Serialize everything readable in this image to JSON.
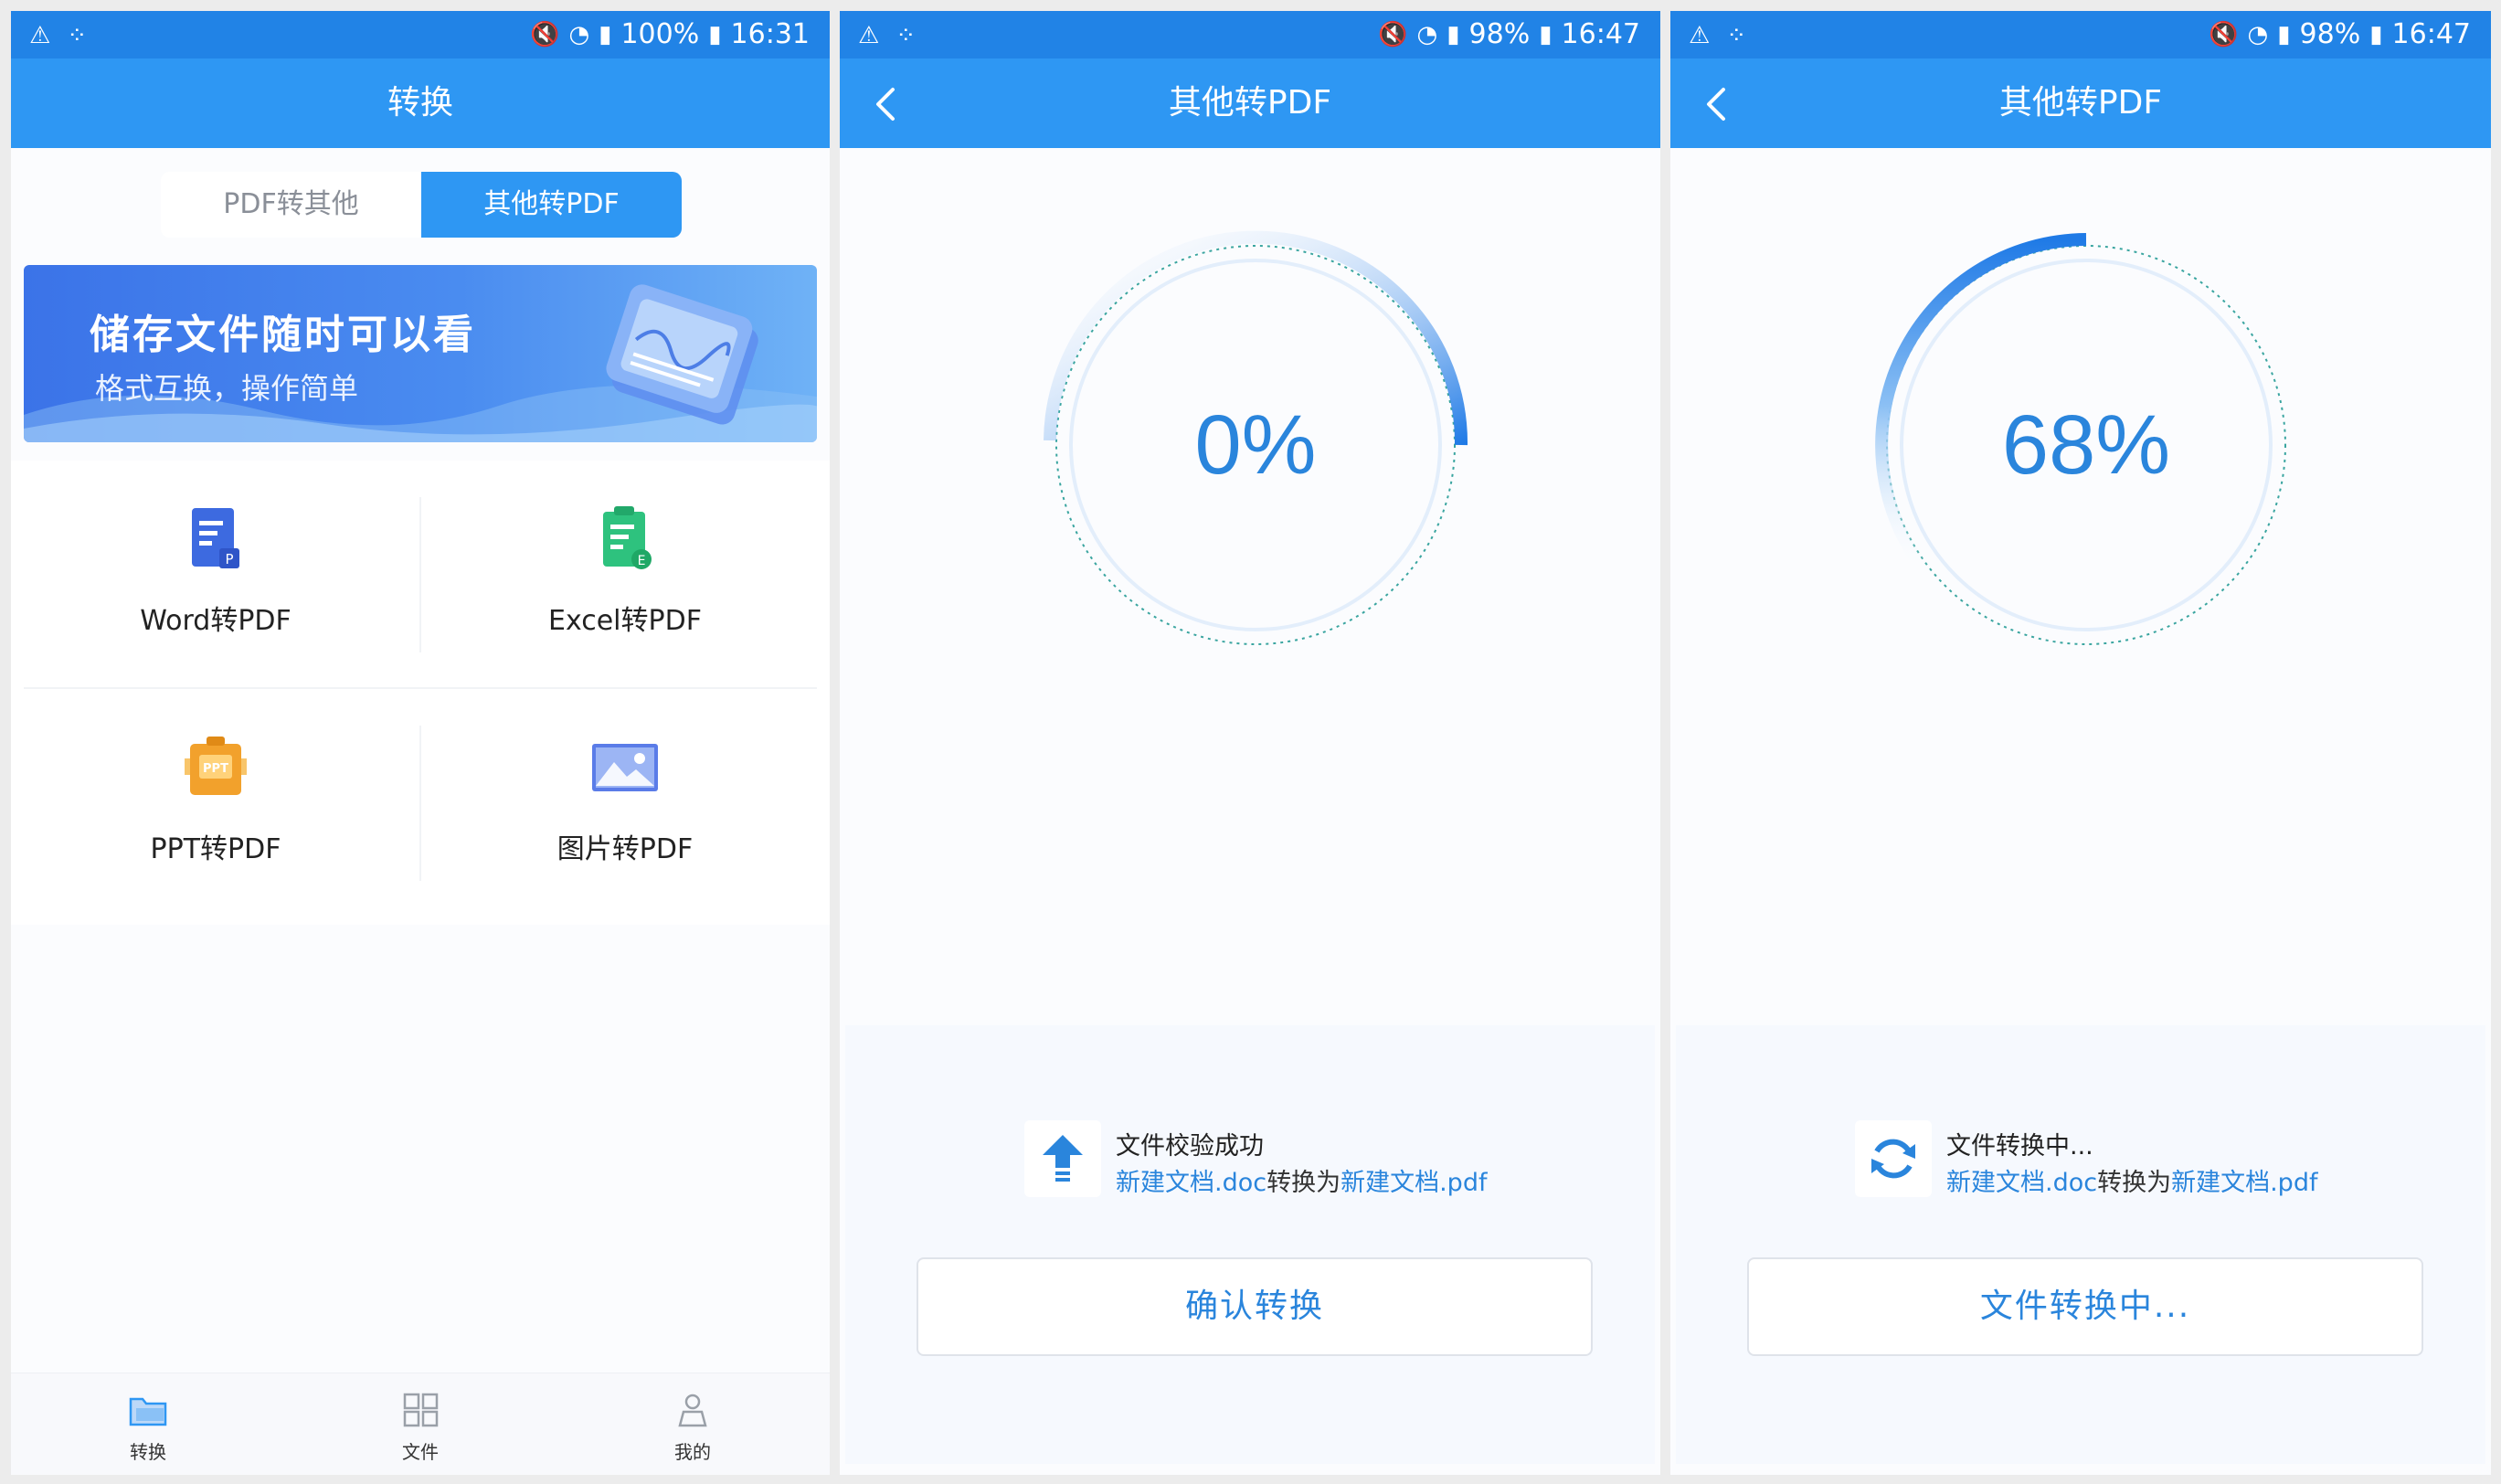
{
  "screens": [
    {
      "status": {
        "battery": "100%",
        "time": "16:31"
      },
      "title": "转换",
      "segment": {
        "left": "PDF转其他",
        "right": "其他转PDF"
      },
      "banner": {
        "title": "储存文件随时可以看",
        "subtitle": "格式互换，操作简单"
      },
      "tools": [
        {
          "label": "Word转PDF",
          "icon": "word-doc-icon",
          "color": "#3d6ae0"
        },
        {
          "label": "Excel转PDF",
          "icon": "excel-doc-icon",
          "color": "#2ec27e"
        },
        {
          "label": "PPT转PDF",
          "icon": "ppt-doc-icon",
          "color": "#f2a12c"
        },
        {
          "label": "图片转PDF",
          "icon": "image-icon",
          "color": "#5a7ce8"
        }
      ],
      "tabs": [
        {
          "label": "转换",
          "icon": "convert-folder-icon"
        },
        {
          "label": "文件",
          "icon": "files-grid-icon"
        },
        {
          "label": "我的",
          "icon": "profile-icon"
        }
      ]
    },
    {
      "status": {
        "battery": "98%",
        "time": "16:47"
      },
      "title": "其他转PDF",
      "progress": {
        "value": 0,
        "text": "0%"
      },
      "file": {
        "status_title": "文件校验成功",
        "source": "新建文档.doc",
        "connector": "转换为",
        "target": "新建文档.pdf",
        "icon": "upload-arrow-icon"
      },
      "button": "确认转换"
    },
    {
      "status": {
        "battery": "98%",
        "time": "16:47"
      },
      "title": "其他转PDF",
      "progress": {
        "value": 68,
        "text": "68%"
      },
      "file": {
        "status_title": "文件转换中...",
        "source": "新建文档.doc",
        "connector": "转换为",
        "target": "新建文档.pdf",
        "icon": "refresh-icon"
      },
      "button": "文件转换中..."
    }
  ],
  "colors": {
    "primary": "#2e97f3",
    "status_bar": "#2183e6",
    "accent_text": "#2a85dc"
  }
}
